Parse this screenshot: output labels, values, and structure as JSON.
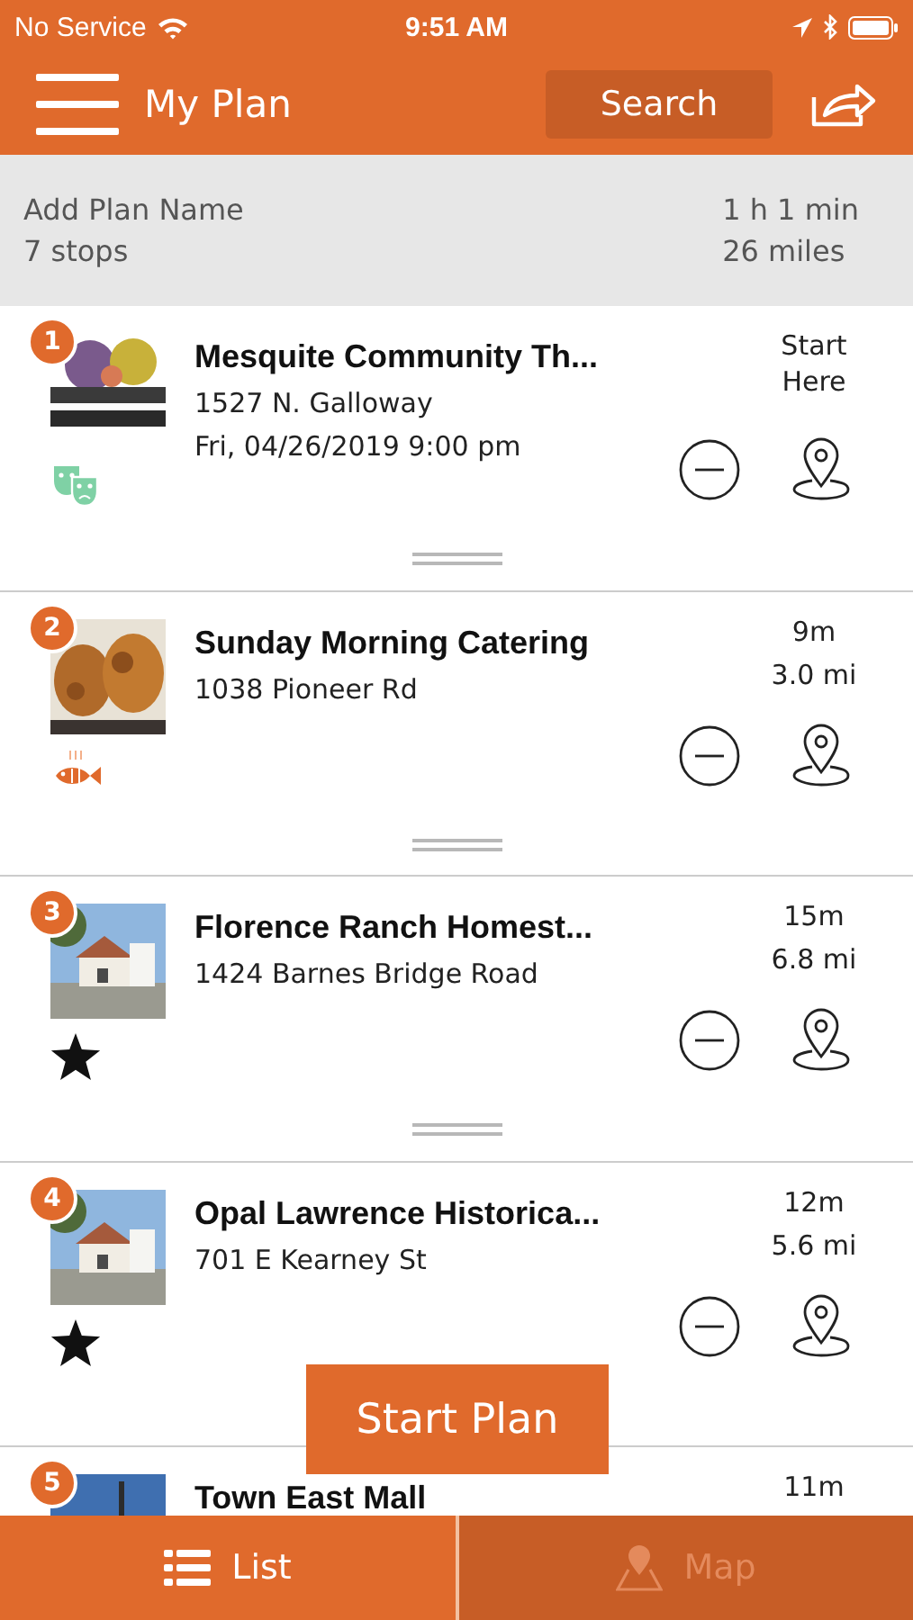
{
  "status_bar": {
    "carrier": "No Service",
    "time": "9:51 AM"
  },
  "header": {
    "title": "My Plan",
    "search_label": "Search"
  },
  "summary": {
    "plan_name": "Add Plan Name",
    "stops": "7 stops",
    "duration": "1 h 1 min",
    "distance": "26 miles"
  },
  "stops": [
    {
      "number": "1",
      "name": "Mesquite Community Th...",
      "address": "1527 N. Galloway",
      "date": "Fri, 04/26/2019 9:00 pm",
      "note": "Start Here",
      "kind": "theater"
    },
    {
      "number": "2",
      "name": "Sunday Morning Catering",
      "address": "1038 Pioneer Rd",
      "time": "9m",
      "distance": "3.0 mi",
      "kind": "food"
    },
    {
      "number": "3",
      "name": "Florence Ranch Homest...",
      "address": "1424 Barnes Bridge Road",
      "time": "15m",
      "distance": "6.8 mi",
      "kind": "star"
    },
    {
      "number": "4",
      "name": "Opal Lawrence Historica...",
      "address": "701 E Kearney St",
      "time": "12m",
      "distance": "5.6 mi",
      "kind": "star"
    },
    {
      "number": "5",
      "name": "Town East Mall",
      "time": "11m"
    }
  ],
  "start_button": "Start Plan",
  "tabs": [
    {
      "label": "List",
      "selected": true
    },
    {
      "label": "Map",
      "selected": false
    }
  ]
}
